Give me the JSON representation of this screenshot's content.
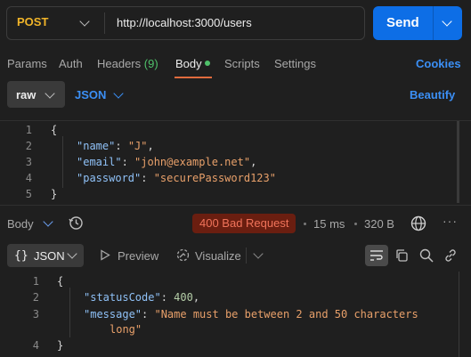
{
  "request": {
    "method": "POST",
    "url": "http://localhost:3000/users",
    "send_label": "Send"
  },
  "tabs": {
    "params": "Params",
    "auth": "Auth",
    "headers": "Headers",
    "headers_count": "(9)",
    "body": "Body",
    "scripts": "Scripts",
    "settings": "Settings",
    "cookies": "Cookies"
  },
  "body_options": {
    "mode": "raw",
    "format": "JSON",
    "beautify": "Beautify"
  },
  "request_body": {
    "line_numbers": [
      "1",
      "2",
      "3",
      "4",
      "5"
    ],
    "open": "{",
    "name_key": "\"name\"",
    "name_val": "\"J\"",
    "email_key": "\"email\"",
    "email_val": "\"john@example.net\"",
    "password_key": "\"password\"",
    "password_val": "\"securePassword123\"",
    "close": "}"
  },
  "response": {
    "section_label": "Body",
    "status": "400 Bad Request",
    "time": "15 ms",
    "size": "320 B",
    "more": "···",
    "format": "JSON",
    "format_icon": "{}",
    "preview": "Preview",
    "visualize": "Visualize",
    "status_color": "#f0735a"
  },
  "response_body": {
    "line_numbers": [
      "1",
      "2",
      "3",
      "",
      "4"
    ],
    "open": "{",
    "status_key": "\"statusCode\"",
    "status_val": "400",
    "message_key": "\"message\"",
    "message_val_1": "\"Name must be between 2 and 50 characters",
    "message_val_2": "long\"",
    "close": "}"
  }
}
